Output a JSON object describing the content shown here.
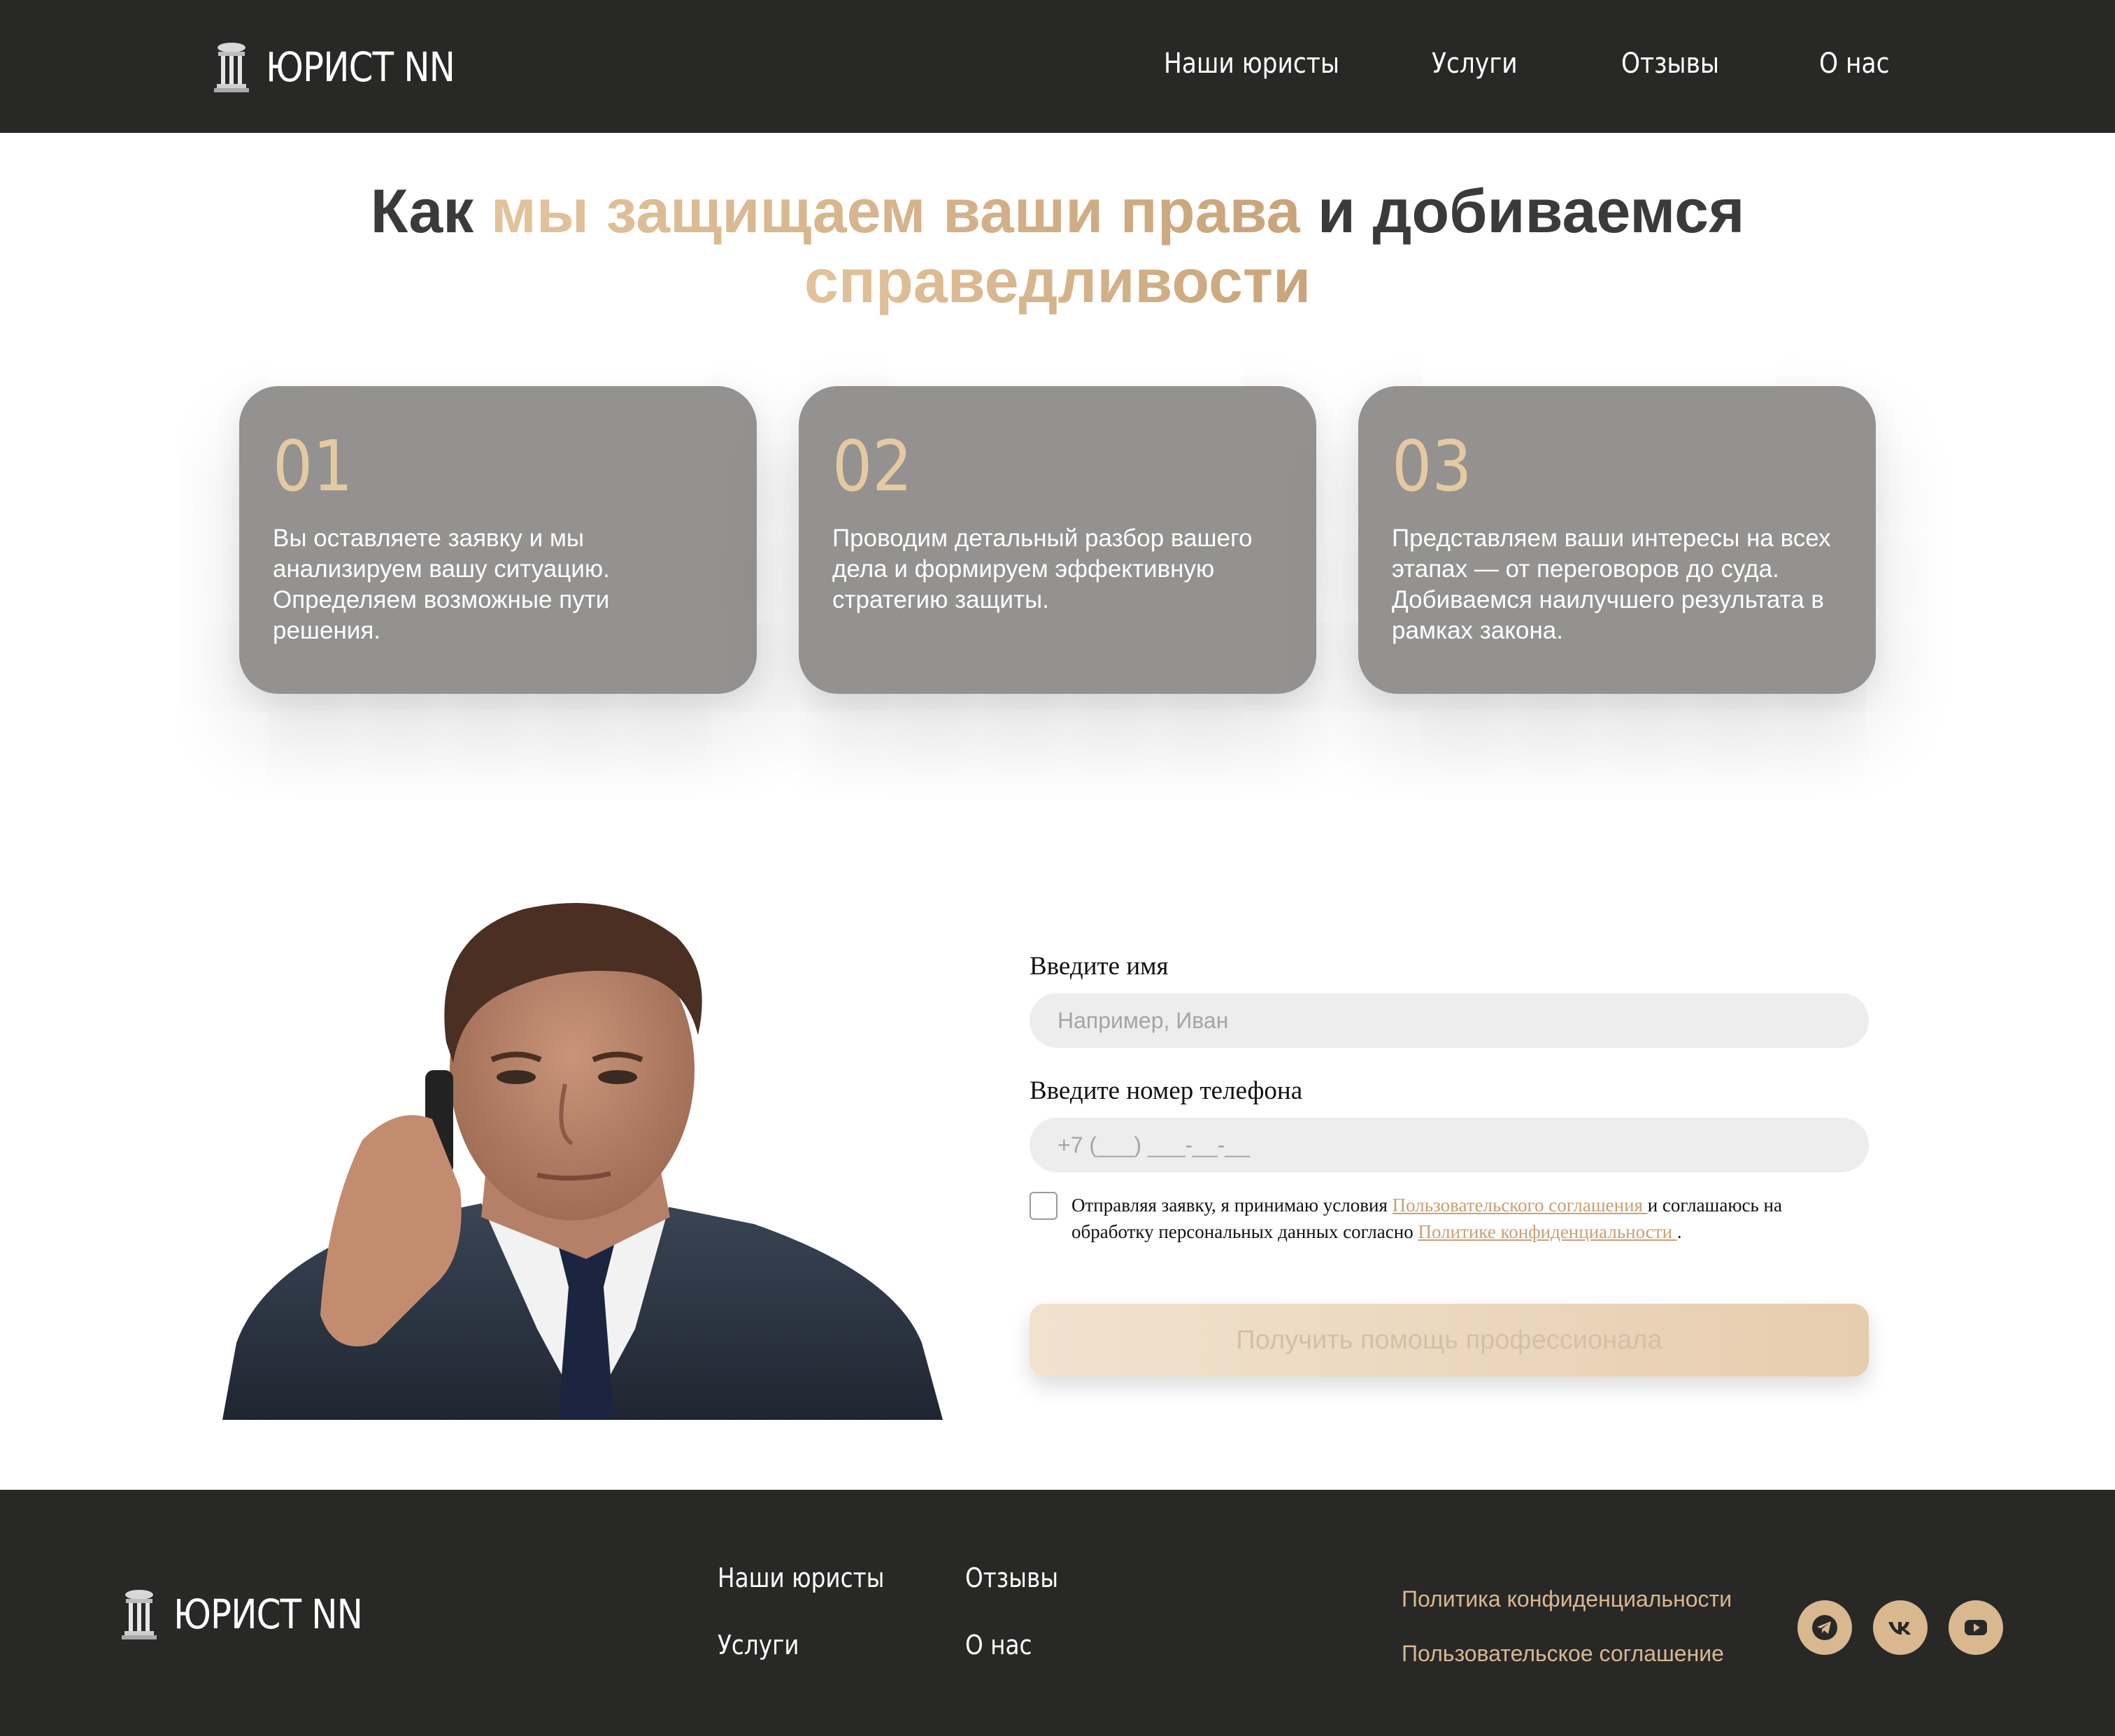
{
  "brand": {
    "name": "ЮРИСТ NN"
  },
  "nav": {
    "items": [
      "Наши юристы",
      "Услуги",
      "Отзывы",
      "О нас"
    ]
  },
  "hero": {
    "title_part1": "Как ",
    "title_highlight1": "мы защищаем ваши права",
    "title_part2": " и добиваемся ",
    "title_highlight2": "справедливости"
  },
  "steps": [
    {
      "number": "01",
      "text": "Вы оставляете заявку и мы анализируем вашу ситуацию. Определяем возможные пути решения."
    },
    {
      "number": "02",
      "text": "Проводим детальный разбор вашего дела и формируем эффективную стратегию защиты."
    },
    {
      "number": "03",
      "text": "Представляем ваши интересы на всех этапах — от переговоров до суда. Добиваемся наилучшего результата в рамках закона."
    }
  ],
  "form": {
    "name_label": "Введите имя",
    "name_placeholder": "Например, Иван",
    "name_value": "",
    "phone_label": "Введите номер телефона",
    "phone_placeholder": "+7 (___) ___-__-__",
    "phone_value": "",
    "agree_text1": "Отправляя заявку, я принимаю условия ",
    "agree_link1": "Пользовательского соглашения ",
    "agree_text2": " и соглашаюсь на обработку персональных данных согласно ",
    "agree_link2": "Политике конфиденциальности ",
    "agree_text3": ".",
    "agree_checked": false,
    "submit_label": "Получить помощь профессионала"
  },
  "footer": {
    "nav_col1": [
      "Наши юристы",
      "Услуги"
    ],
    "nav_col2": [
      "Отзывы",
      "О нас"
    ],
    "privacy_link": "Политика конфиденциальности",
    "terms_link": "Пользовательское соглашение",
    "social": [
      "telegram-icon",
      "vk-icon",
      "youtube-icon"
    ]
  },
  "colors": {
    "dark": "#282827",
    "gold": "#d9b88f",
    "card": "#939291"
  }
}
